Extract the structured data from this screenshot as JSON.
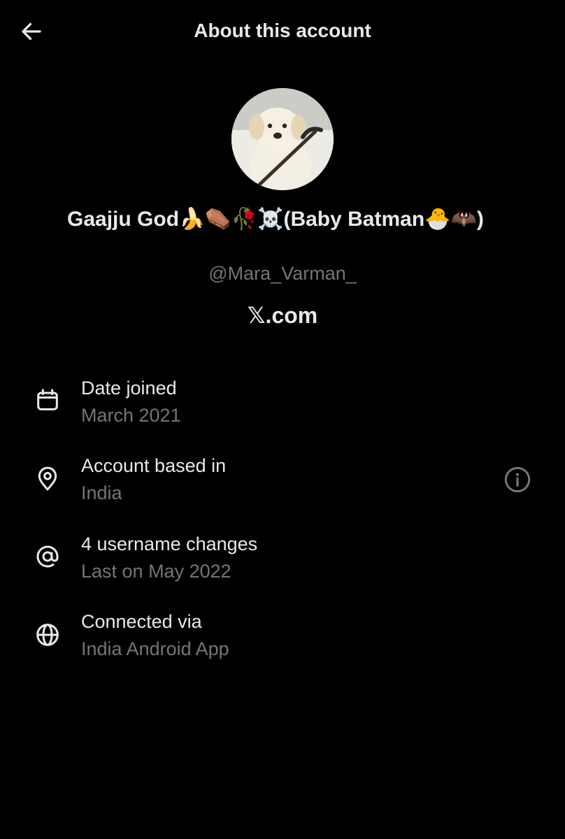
{
  "header": {
    "title": "About this account",
    "back_icon": "arrow-left-icon"
  },
  "profile": {
    "name_text": "Gaajju God",
    "name_emojis_1": "🍌⚰️🥀☠️",
    "name_paren_text": "(Baby Batman",
    "name_emojis_2": "🐣🦇",
    "name_close": ")",
    "handle": "@Mara_Varman_",
    "platform": "𝕏.com",
    "avatar_icon": "dog-with-scythe-avatar"
  },
  "details": [
    {
      "icon": "calendar-icon",
      "label": "Date joined",
      "value": "March 2021"
    },
    {
      "icon": "location-pin-icon",
      "label": "Account based in",
      "value": "India",
      "action_icon": "info-icon"
    },
    {
      "icon": "at-sign-icon",
      "label": "4 username changes",
      "value": "Last on May 2022"
    },
    {
      "icon": "globe-icon",
      "label": "Connected via",
      "value": "India Android App"
    }
  ],
  "colors": {
    "background": "#000000",
    "primary_text": "#e7e9ea",
    "secondary_text": "#71767b"
  }
}
